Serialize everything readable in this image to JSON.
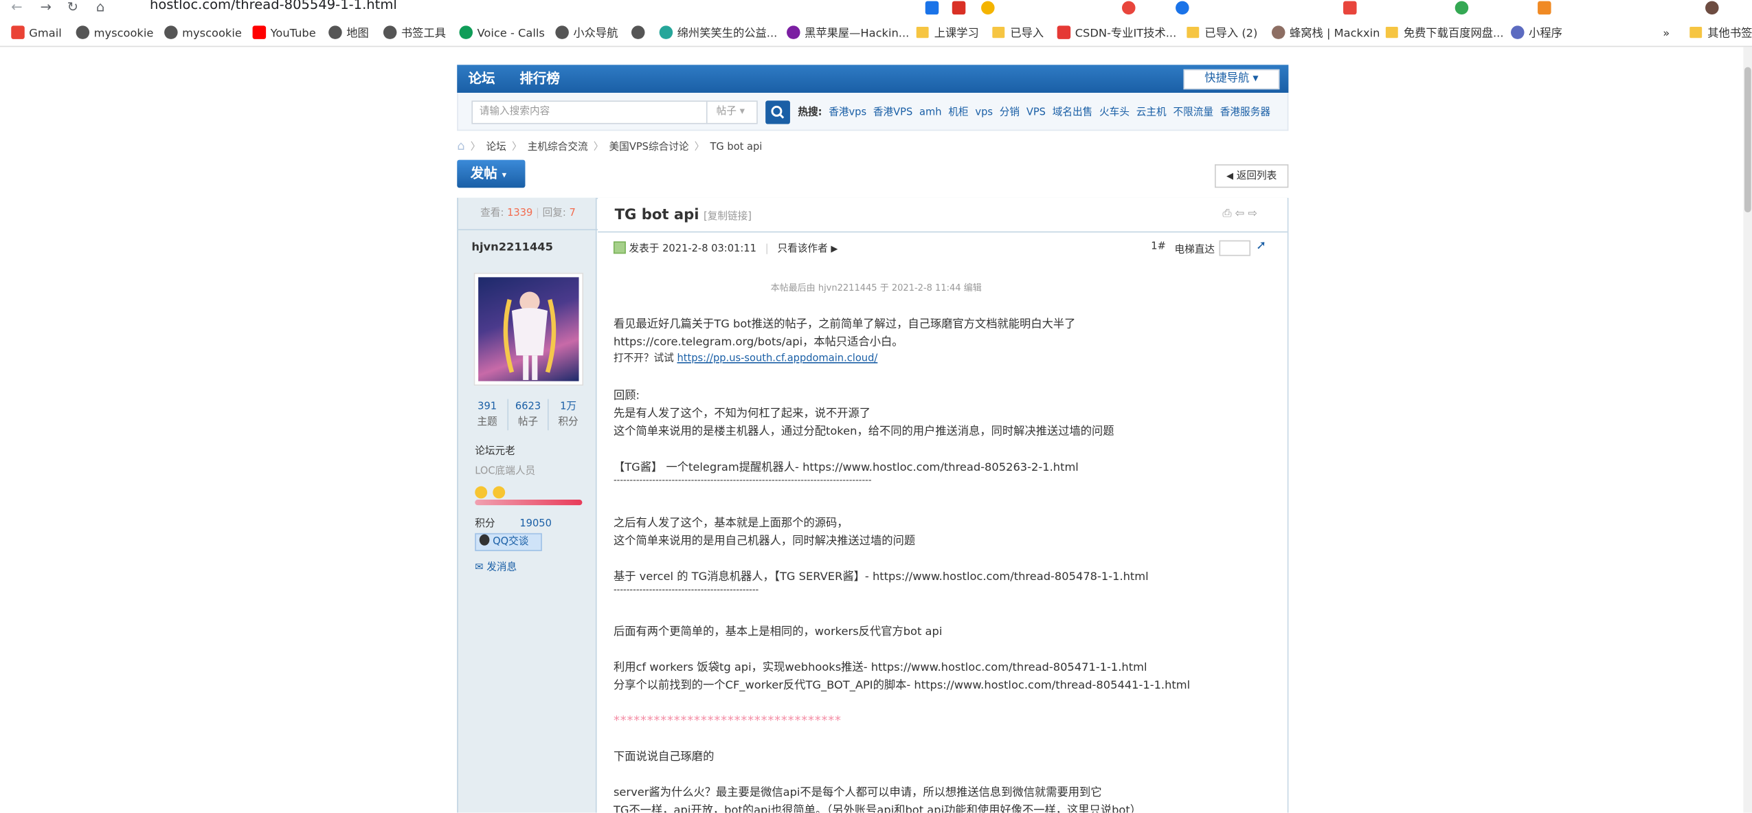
{
  "browser": {
    "url": "hostloc.com/thread-805549-1-1.html",
    "bookmarks": [
      "Gmail",
      "myscookie",
      "myscookie",
      "YouTube",
      "地图",
      "书签工具",
      "Voice - Calls",
      "小众导航",
      "",
      "绵州笑笑生的公益...",
      "黑苹果屋—Hackin...",
      "上课学习",
      "已导入",
      "CSDN-专业IT技术...",
      "已导入 (2)",
      "蜂窝栈 | Mackxin",
      "免费下载百度网盘...",
      "小程序"
    ],
    "bookmarks_overflow": "»",
    "other_bookmarks": "其他书签"
  },
  "nav": {
    "tabs": [
      "论坛",
      "排行榜"
    ],
    "quick_nav": "快捷导航"
  },
  "search": {
    "placeholder": "请输入搜索内容",
    "type": "帖子",
    "hot_label": "热搜:",
    "hot_terms": [
      "香港vps",
      "香港VPS",
      "amh",
      "机柜",
      "vps",
      "分销",
      "VPS",
      "域名出售",
      "火车头",
      "云主机",
      "不限流量",
      "香港服务器"
    ]
  },
  "breadcrumb": [
    "论坛",
    "主机综合交流",
    "美国VPS综合讨论",
    "TG bot api"
  ],
  "buttons": {
    "post": "发帖",
    "back": "返回列表"
  },
  "thread": {
    "views_label": "查看:",
    "views": "1339",
    "replies_label": "回复:",
    "replies": "7",
    "title": "TG bot api",
    "copy_link": "[复制链接]"
  },
  "author": {
    "name": "hjvn2211445",
    "topics": "391",
    "topics_label": "主题",
    "posts": "6623",
    "posts_label": "帖子",
    "credits": "1万",
    "credits_label": "积分",
    "group": "论坛元老",
    "rank": "LOC底端人员",
    "score_label": "积分",
    "score": "19050",
    "qq": "QQ交谈",
    "message": "发消息"
  },
  "post": {
    "posted": "发表于 2021-2-8 03:01:11",
    "only_author": "只看该作者",
    "floor": "1#",
    "jump_label": "电梯直达",
    "edited": "本帖最后由 hjvn2211445 于 2021-2-8 11:44 编辑",
    "lines": [
      "看见最近好几篇关于TG bot推送的帖子，之前简单了解过，自己琢磨官方文档就能明白大半了",
      "https://core.telegram.org/bots/api，本帖只适合小白。",
      "打不开？试试",
      "https://pp.us-south.cf.appdomain.cloud/",
      "回顾:",
      "先是有人发了这个，不知为何杠了起来，说不开源了",
      "这个简单来说用的是楼主机器人，通过分配token，给不同的用户推送消息，同时解决推送过墙的问题",
      "【TG酱】 一个telegram提醒机器人- https://www.hostloc.com/thread-805263-2-1.html",
      "--------------------------------------------------------------------------------",
      "之后有人发了这个，基本就是上面那个的源码，",
      "这个简单来说用的是用自己机器人，同时解决推送过墙的问题",
      "基于 vercel 的 TG消息机器人，【TG SERVER酱】- https://www.hostloc.com/thread-805478-1-1.html",
      "---------------------------------------------",
      "后面有两个更简单的，基本上是相同的，workers反代官方bot api",
      "利用cf workers 饭袋tg api，实现webhooks推送- https://www.hostloc.com/thread-805471-1-1.html",
      "分享个以前找到的一个CF_worker反代TG_BOT_API的脚本- https://www.hostloc.com/thread-805441-1-1.html",
      "**********************************",
      "下面说说自己琢磨的",
      "server酱为什么火？最主要是微信api不是每个人都可以申请，所以想推送信息到微信就需要用到它",
      "TG不一样，api开放，bot的api也很简单。（另外账号api和bot api功能和使用好像不一样，这里只说bot）"
    ]
  }
}
